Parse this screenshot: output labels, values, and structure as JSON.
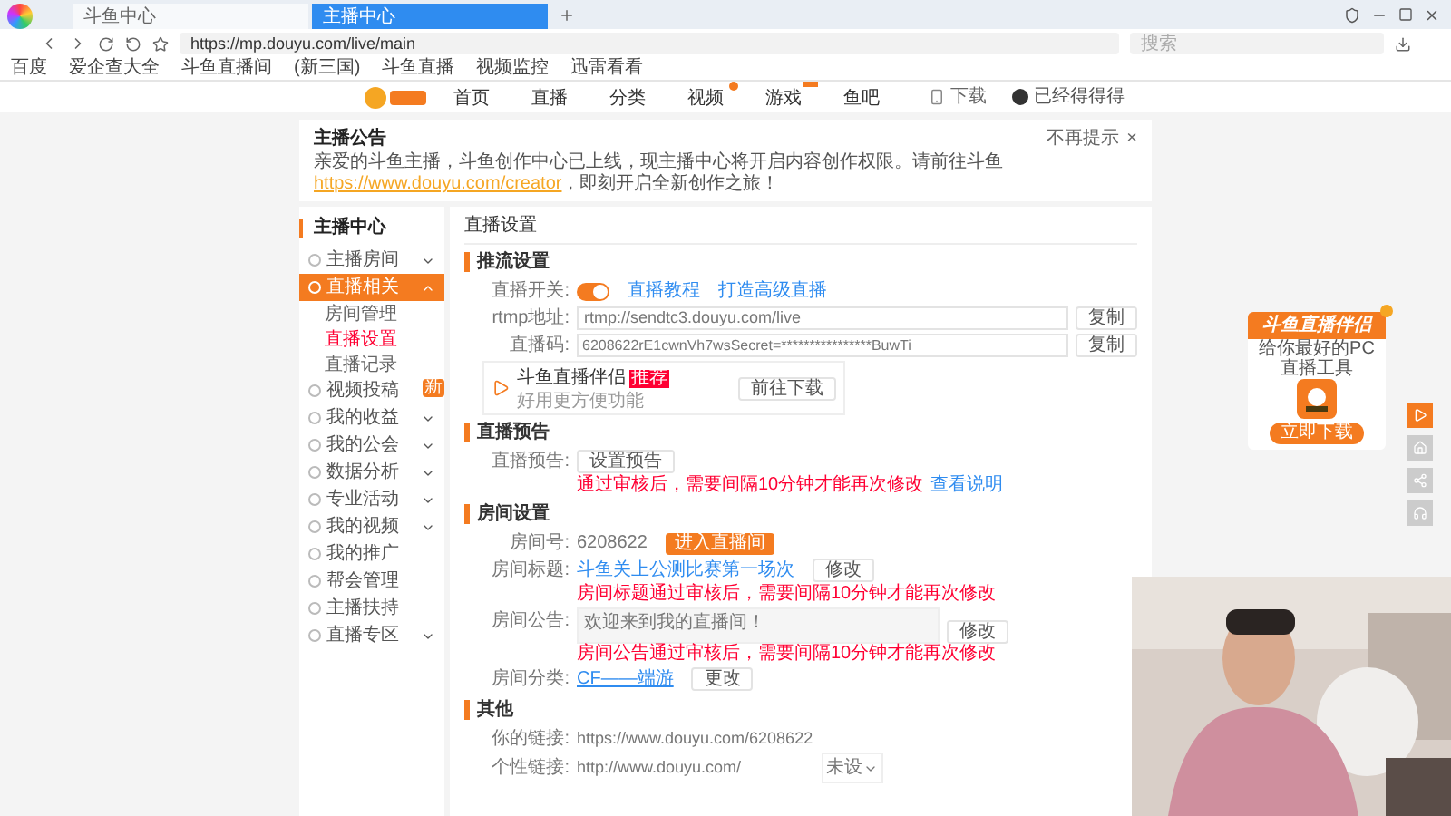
{
  "browser": {
    "tabs": [
      {
        "title": "斗鱼中心",
        "selected": false
      },
      {
        "title": "主播中心",
        "selected": true
      }
    ],
    "url": "https://mp.douyu.com/live/main",
    "search": {
      "placeholder": "搜索"
    },
    "bookmarks": [
      "百度",
      "爱企查大全",
      "斗鱼直播间",
      "(新三国)",
      "斗鱼直播",
      "视频监控",
      "迅雷看看"
    ]
  },
  "site_nav": {
    "items": [
      {
        "label": "首页",
        "dot": false,
        "tag": false
      },
      {
        "label": "直播",
        "dot": false,
        "tag": false
      },
      {
        "label": "分类",
        "dot": false,
        "tag": false
      },
      {
        "label": "视频",
        "dot": true,
        "tag": false
      },
      {
        "label": "游戏",
        "dot": false,
        "tag": true
      },
      {
        "label": "鱼吧",
        "dot": false,
        "tag": false
      }
    ],
    "download": "下载",
    "user": "已经得得得"
  },
  "notice": {
    "title": "主播公告",
    "text": "亲爱的斗鱼主播，斗鱼创作中心已上线，现主播中心将开启内容创作权限。请前往斗鱼",
    "link": "https://www.douyu.com/creator",
    "tail": "，即刻开启全新创作之旅！",
    "dismiss": "不再提示",
    "close": "×"
  },
  "sidebar": {
    "title": "主播中心",
    "items": [
      {
        "label": "主播房间",
        "expanded": false,
        "selected": false
      },
      {
        "label": "直播相关",
        "expanded": true,
        "selected": true,
        "children": [
          {
            "label": "房间管理",
            "selected": false
          },
          {
            "label": "直播设置",
            "selected": true
          },
          {
            "label": "直播记录",
            "selected": false
          }
        ]
      },
      {
        "label": "视频投稿",
        "badge": "新",
        "selected": false
      },
      {
        "label": "我的收益",
        "expanded": false,
        "selected": false
      },
      {
        "label": "我的公会",
        "expanded": false,
        "selected": false
      },
      {
        "label": "数据分析",
        "expanded": false,
        "selected": false
      },
      {
        "label": "专业活动",
        "expanded": false,
        "selected": false
      },
      {
        "label": "我的视频",
        "expanded": false,
        "selected": false
      },
      {
        "label": "我的推广",
        "selected": false
      },
      {
        "label": "帮会管理",
        "selected": false
      },
      {
        "label": "主播扶持",
        "selected": false
      },
      {
        "label": "直播专区",
        "expanded": false,
        "selected": false
      }
    ]
  },
  "main": {
    "title": "直播设置",
    "stream": {
      "heading": "推流设置",
      "switch": {
        "label": "直播开关:",
        "on": true
      },
      "links": [
        "直播教程",
        "打造高级直播"
      ],
      "rtmp": {
        "label": "rtmp地址:",
        "value": "rtmp://sendtc3.douyu.com/live",
        "copy": "复制"
      },
      "code": {
        "label": "直播码:",
        "value": "6208622rE1cwnVh7wsSecret=****************BuwTi",
        "copy": "复制"
      },
      "companion": {
        "name": "斗鱼直播伴侣",
        "badge": "推荐",
        "tagline": "好用更方便功能",
        "button": "前往下载"
      }
    },
    "preview": {
      "heading": "直播预告",
      "label": "直播预告:",
      "button": "设置预告",
      "warning": "通过审核后，需要间隔10分钟才能再次修改",
      "link": "查看说明"
    },
    "room": {
      "heading": "房间设置",
      "id": {
        "label": "房间号:",
        "value": "6208622",
        "button": "进入直播间"
      },
      "title": {
        "label": "房间标题:",
        "value": "斗鱼关上公测比赛第一场次",
        "button": "修改",
        "warning": "房间标题通过审核后，需要间隔10分钟才能再次修改"
      },
      "notice": {
        "label": "房间公告:",
        "value": "欢迎来到我的直播间！",
        "button": "修改",
        "warning": "房间公告通过审核后，需要间隔10分钟才能再次修改"
      },
      "category": {
        "label": "房间分类:",
        "value": "CF——端游",
        "button": "更改"
      }
    },
    "other": {
      "heading": "其他",
      "links": [
        {
          "label": "你的链接:",
          "value": "https://www.douyu.com/6208622"
        },
        {
          "label": "个性链接:",
          "value": "http://www.douyu.com/",
          "select": "未设"
        }
      ]
    }
  },
  "promo": {
    "title": "斗鱼直播伴侣",
    "text": "给你最好的PC直播工具",
    "button": "立即下载"
  }
}
